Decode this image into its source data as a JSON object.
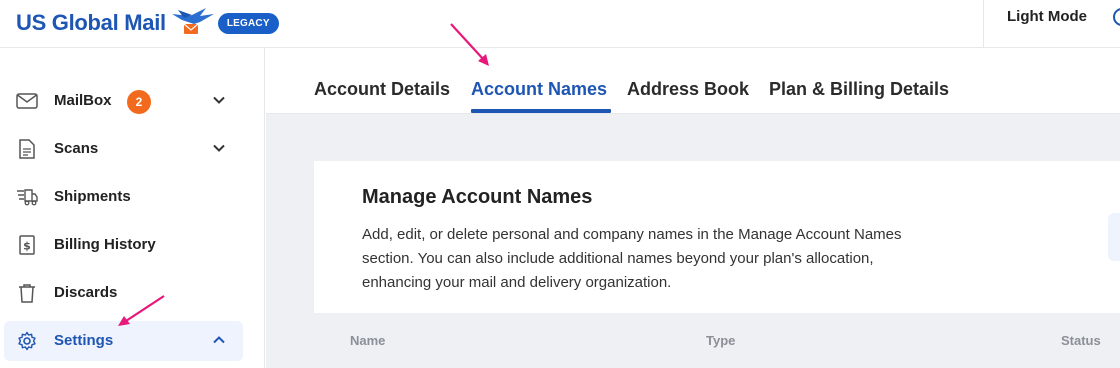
{
  "header": {
    "brand": "US Global Mail",
    "badge": "LEGACY",
    "light_mode_label": "Light Mode"
  },
  "sidebar": {
    "items": [
      {
        "label": "MailBox",
        "icon": "envelope-icon",
        "badge": "2",
        "expandable": true
      },
      {
        "label": "Scans",
        "icon": "document-icon",
        "expandable": true
      },
      {
        "label": "Shipments",
        "icon": "truck-icon"
      },
      {
        "label": "Billing History",
        "icon": "dollar-receipt-icon"
      },
      {
        "label": "Discards",
        "icon": "trash-icon"
      },
      {
        "label": "Settings",
        "icon": "gear-icon",
        "expandable": true,
        "expanded": true,
        "active": true
      }
    ]
  },
  "tabs": [
    {
      "label": "Account Details"
    },
    {
      "label": "Account Names",
      "active": true
    },
    {
      "label": "Address Book"
    },
    {
      "label": "Plan & Billing Details"
    }
  ],
  "manage": {
    "title": "Manage Account Names",
    "description": "Add, edit, or delete personal and company names in the Manage Account Names section. You can also include additional names beyond your plan's allocation, enhancing your mail and delivery organization."
  },
  "table": {
    "columns": [
      "Name",
      "Type",
      "Status"
    ]
  },
  "colors": {
    "brand_blue": "#1e56b3",
    "badge_orange": "#f26a1e",
    "annotation_pink": "#e8177a"
  }
}
